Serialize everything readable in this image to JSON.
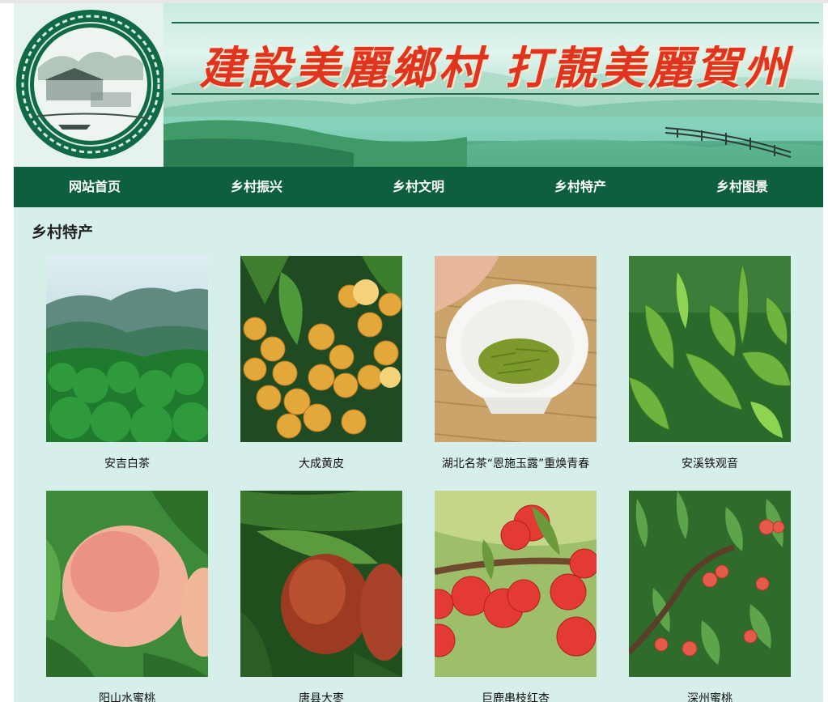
{
  "banner": {
    "title": "建設美麗鄉村 打靚美麗賀州"
  },
  "nav": {
    "items": [
      {
        "label": "网站首页"
      },
      {
        "label": "乡村振兴"
      },
      {
        "label": "乡村文明"
      },
      {
        "label": "乡村特产"
      },
      {
        "label": "乡村图景"
      }
    ]
  },
  "section": {
    "title": "乡村特产"
  },
  "products": [
    {
      "name": "安吉白茶",
      "image": "mountain-forest-photo"
    },
    {
      "name": "大成黄皮",
      "image": "wampee-fruit-photo"
    },
    {
      "name": "湖北名茶“恩施玉露”重焕青春",
      "image": "green-tea-cup-photo"
    },
    {
      "name": "安溪铁观音",
      "image": "tea-leaves-photo"
    },
    {
      "name": "阳山水蜜桃",
      "image": "peach-photo"
    },
    {
      "name": "唐县大枣",
      "image": "red-fruit-photo"
    },
    {
      "name": "巨鹿串枝红杏",
      "image": "apricot-branch-photo"
    },
    {
      "name": "深州蜜桃",
      "image": "peach-tree-photo"
    }
  ],
  "colors": {
    "nav_bg": "#0d5f3d",
    "page_bg": "#d7efea",
    "title_red": "#e0341e"
  }
}
